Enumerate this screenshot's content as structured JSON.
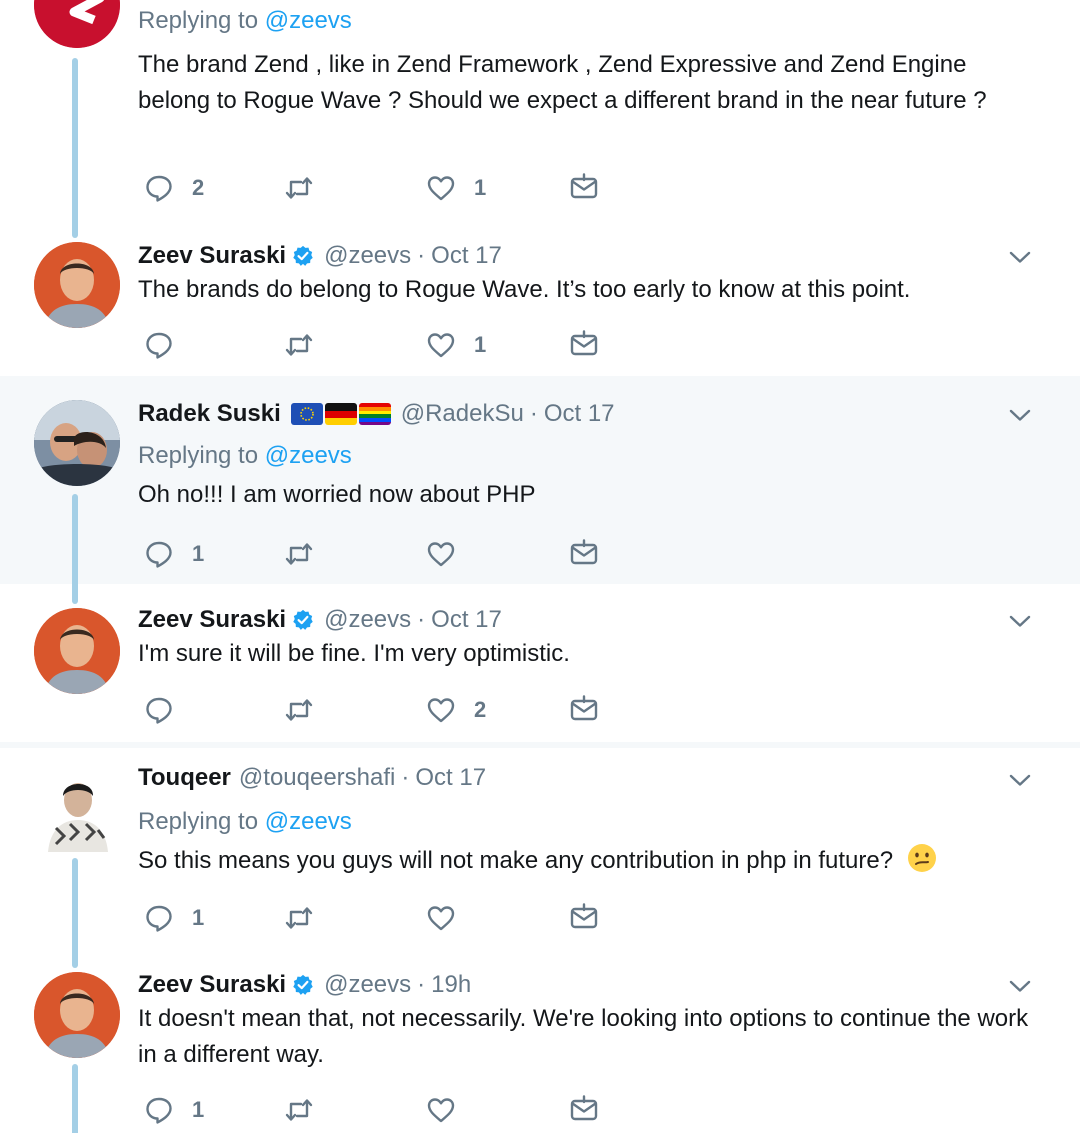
{
  "tweets": [
    {
      "replying_prefix": "Replying to",
      "replying_to": "@zeevs",
      "text": "The brand Zend , like in Zend Framework , Zend Expressive and Zend Engine belong to Rogue Wave ?  Should we expect a different brand in the near future ?",
      "replies": "2",
      "retweets": "",
      "likes": "1"
    },
    {
      "name": "Zeev Suraski",
      "verified": true,
      "handle": "@zeevs",
      "time": "Oct 17",
      "text": "The brands do belong to Rogue Wave.  It’s too early to know at this point.",
      "replies": "",
      "retweets": "",
      "likes": "1"
    },
    {
      "name": "Radek Suski",
      "handle": "@RadekSu",
      "time": "Oct 17",
      "flags": [
        "eu-flag",
        "germany-flag",
        "rainbow-flag"
      ],
      "replying_prefix": "Replying to",
      "replying_to": "@zeevs",
      "text": "Oh no!!! I am worried now about PHP",
      "replies": "1",
      "retweets": "",
      "likes": ""
    },
    {
      "name": "Zeev Suraski",
      "verified": true,
      "handle": "@zeevs",
      "time": "Oct 17",
      "text": "I'm sure it will be fine.  I'm very optimistic.",
      "replies": "",
      "retweets": "",
      "likes": "2"
    },
    {
      "name": "Touqeer",
      "handle": "@touqeershafi",
      "time": "Oct 17",
      "replying_prefix": "Replying to",
      "replying_to": "@zeevs",
      "text": "So this means you guys will not make any contribution in php in future?",
      "emoji": "confused-face-emoji",
      "replies": "1",
      "retweets": "",
      "likes": ""
    },
    {
      "name": "Zeev Suraski",
      "verified": true,
      "handle": "@zeevs",
      "time": "19h",
      "text": "It doesn't mean that, not necessarily.  We're looking into options to continue the work in a different way.",
      "replies": "1",
      "retweets": "",
      "likes": ""
    }
  ],
  "separator": "·",
  "colors": {
    "accent": "#1da1f2",
    "secondary_text": "#657786",
    "highlight_bg": "#f5f8fa",
    "thread_line": "#a4cfe6"
  }
}
